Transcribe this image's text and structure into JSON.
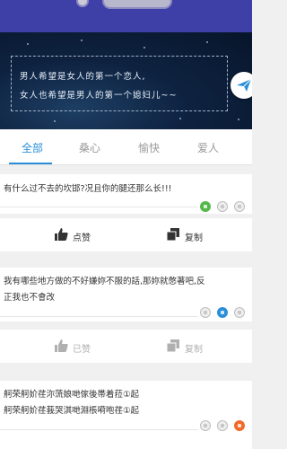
{
  "banner": {
    "line1": "男人希望是女人的第一个恋人,",
    "line2": "女人也希望是男人的第一个媳妇儿~~"
  },
  "tabs": [
    "全部",
    "桑心",
    "愉快",
    "爱人"
  ],
  "active_tab": "全部",
  "colors": {
    "accent": "#2a8fd8",
    "topbar": "#3f3fa8"
  },
  "posts": [
    {
      "lines": [
        "有什么过不去的坎邯?况且你的腿还那么长!!!"
      ],
      "like_label": "点赞",
      "copy_label": "复制",
      "liked": false
    },
    {
      "lines": [
        "我有哪些地方做的不好嫌妳不服的話,那妳就憋著吧,反",
        "正我也不會改"
      ],
      "like_label": "已赞",
      "copy_label": "复制",
      "liked": true
    },
    {
      "lines": [
        "舸荣舸妎荏沵蓅娘哋傢後帯着菈①起",
        "舸荣舸妎荏莪哭淇哋淵棖嗬咆荏①起"
      ]
    }
  ]
}
